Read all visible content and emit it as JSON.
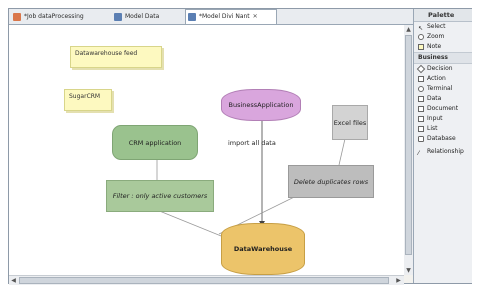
{
  "tabs": [
    {
      "label": "*Job dataProcessing",
      "icon": "job-icon"
    },
    {
      "label": "Model Data",
      "icon": "model-icon"
    },
    {
      "label": "*Model Divi Nant",
      "icon": "model-icon",
      "close": "✕"
    }
  ],
  "notes": [
    {
      "text": "Datawarehouse feed"
    },
    {
      "text": "SugarCRM"
    }
  ],
  "nodes": {
    "business_application": "BusinessApplication",
    "crm_application": "CRM application",
    "filter": "Filter : only active customers",
    "delete_duplicates": "Delete duplicates rows",
    "excel_files": "Excel files",
    "datawarehouse": "DataWarehouse"
  },
  "connection_label": "import all data",
  "palette": {
    "title": "Palette",
    "tools": [
      {
        "label": "Select",
        "icon": "select-arrow-icon"
      },
      {
        "label": "Zoom",
        "icon": "zoom-icon"
      },
      {
        "label": "Note",
        "icon": "note-icon"
      }
    ],
    "group": "Business",
    "shapes": [
      {
        "label": "Decision",
        "icon": "decision-icon"
      },
      {
        "label": "Action",
        "icon": "action-icon"
      },
      {
        "label": "Terminal",
        "icon": "terminal-icon"
      },
      {
        "label": "Data",
        "icon": "data-icon"
      },
      {
        "label": "Document",
        "icon": "document-icon"
      },
      {
        "label": "Input",
        "icon": "input-icon"
      },
      {
        "label": "List",
        "icon": "list-icon"
      },
      {
        "label": "Database",
        "icon": "database-icon"
      }
    ],
    "connection": {
      "label": "Relationship",
      "icon": "relationship-icon"
    }
  },
  "colors": {
    "note": "#fdf9c0",
    "crm": "#9ac28e",
    "business": "#d9a6dd",
    "filter": "#a9c99b",
    "grey_node": "#bdbdbd",
    "datawarehouse": "#ecc46a"
  }
}
